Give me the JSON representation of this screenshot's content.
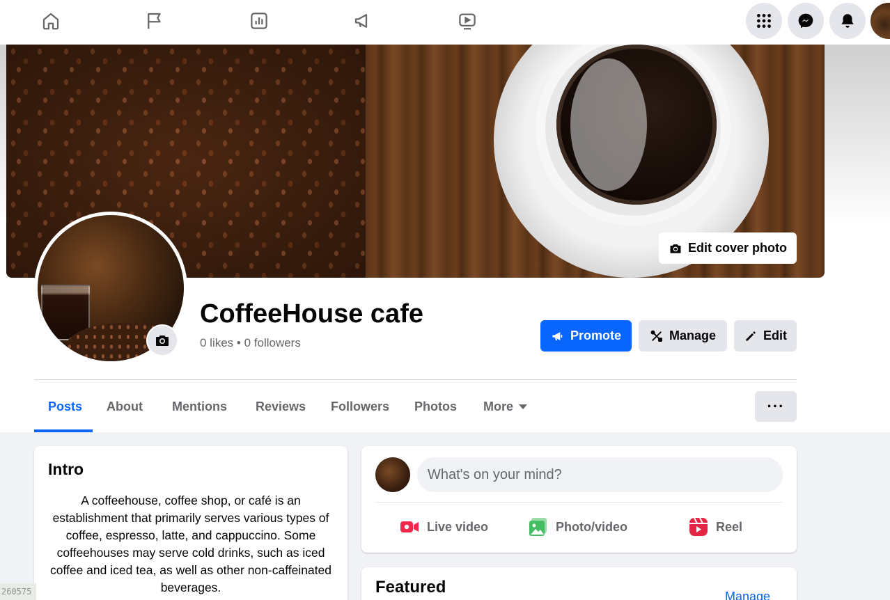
{
  "topnav": {
    "icons": [
      "home-icon",
      "flag-icon",
      "insights-icon",
      "megaphone-icon",
      "video-icon"
    ],
    "right_icons": [
      "menu-grid-icon",
      "messenger-icon",
      "bell-icon"
    ]
  },
  "cover": {
    "edit_label": "Edit cover photo"
  },
  "page": {
    "name": "CoffeeHouse cafe",
    "stats": "0 likes • 0 followers"
  },
  "actions": {
    "promote": "Promote",
    "manage": "Manage",
    "edit": "Edit"
  },
  "tabs": [
    {
      "label": "Posts",
      "active": true
    },
    {
      "label": "About",
      "active": false
    },
    {
      "label": "Mentions",
      "active": false
    },
    {
      "label": "Reviews",
      "active": false
    },
    {
      "label": "Followers",
      "active": false
    },
    {
      "label": "Photos",
      "active": false
    },
    {
      "label": "More",
      "active": false
    }
  ],
  "more_options": "···",
  "intro": {
    "title": "Intro",
    "text": "A coffeehouse, coffee shop, or café is an establishment that primarily serves various types of coffee, espresso, latte, and cappuccino. Some coffeehouses may serve cold drinks, such as iced coffee and iced tea, as well as other non-caffeinated beverages."
  },
  "composer": {
    "placeholder": "What's on your mind?",
    "live_video": "Live video",
    "photo_video": "Photo/video",
    "reel": "Reel"
  },
  "featured": {
    "title": "Featured",
    "manage": "Manage"
  },
  "corner_label": "260575",
  "colors": {
    "accent": "#0866ff",
    "live": "#f02849",
    "photo": "#45bd62",
    "reel": "#e42645"
  }
}
